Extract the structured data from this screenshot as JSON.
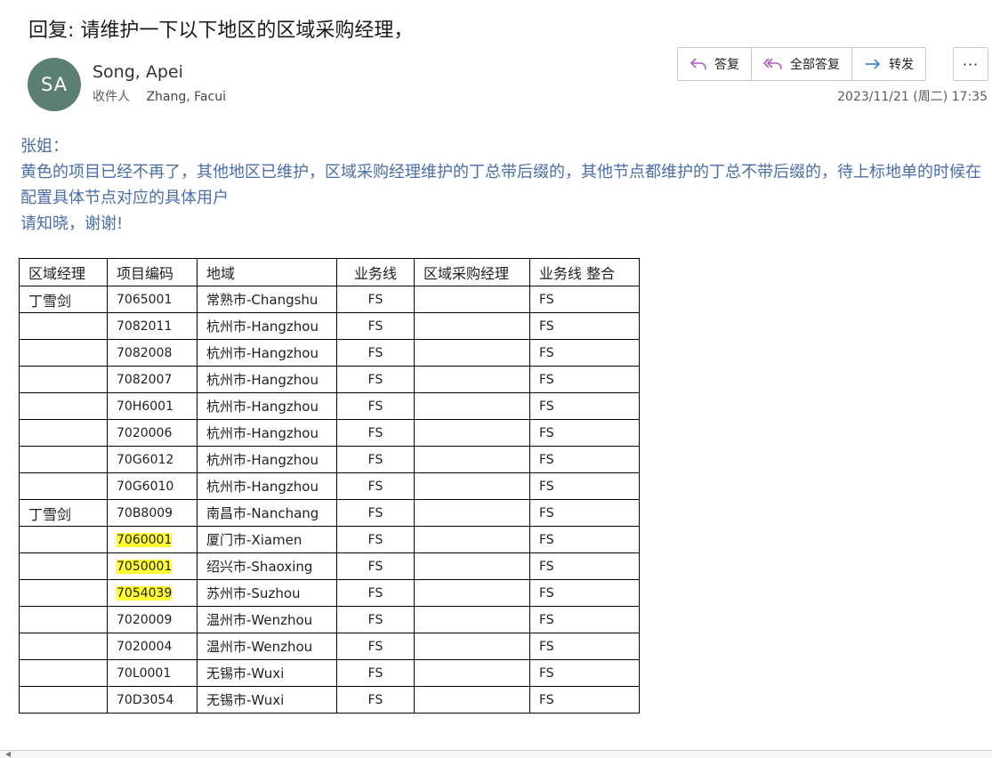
{
  "email": {
    "subject": "回复: 请维护一下以下地区的区域采购经理，",
    "avatar_initials": "SA",
    "sender": "Song, Apei",
    "to_label": "收件人",
    "to_name": "Zhang, Facui",
    "datetime": "2023/11/21 (周二) 17:35",
    "body": [
      "张姐：",
      "黄色的项目已经不再了，其他地区已维护，区域采购经理维护的丁总带后缀的，其他节点都维护的丁总不带后缀的，待上标地单的时候在配置具体节点对应的具体用户",
      "请知晓，谢谢!"
    ]
  },
  "actions": {
    "reply": "答复",
    "reply_all": "全部答复",
    "forward": "转发",
    "more": "···"
  },
  "colors": {
    "body_text": "#4a6ea9",
    "highlight": "#ffff33",
    "avatar": "#5b7f72",
    "reply_icon": "#b05fbf",
    "forward_icon": "#2a7fd4"
  },
  "table": {
    "headers": [
      "区域经理",
      "项目编码",
      "地域",
      "业务线",
      "区域采购经理",
      "业务线 整合"
    ],
    "rows": [
      {
        "manager": "丁雪剑",
        "code": "7065001",
        "location": "常熟市-Changshu",
        "line": "FS",
        "buyer": "",
        "merged": "FS",
        "highlight": false
      },
      {
        "manager": "",
        "code": "7082011",
        "location": "杭州市-Hangzhou",
        "line": "FS",
        "buyer": "",
        "merged": "FS",
        "highlight": false
      },
      {
        "manager": "",
        "code": "7082008",
        "location": "杭州市-Hangzhou",
        "line": "FS",
        "buyer": "",
        "merged": "FS",
        "highlight": false
      },
      {
        "manager": "",
        "code": "7082007",
        "location": "杭州市-Hangzhou",
        "line": "FS",
        "buyer": "",
        "merged": "FS",
        "highlight": false
      },
      {
        "manager": "",
        "code": "70H6001",
        "location": "杭州市-Hangzhou",
        "line": "FS",
        "buyer": "",
        "merged": "FS",
        "highlight": false
      },
      {
        "manager": "",
        "code": "7020006",
        "location": "杭州市-Hangzhou",
        "line": "FS",
        "buyer": "",
        "merged": "FS",
        "highlight": false
      },
      {
        "manager": "",
        "code": "70G6012",
        "location": "杭州市-Hangzhou",
        "line": "FS",
        "buyer": "",
        "merged": "FS",
        "highlight": false
      },
      {
        "manager": "",
        "code": "70G6010",
        "location": "杭州市-Hangzhou",
        "line": "FS",
        "buyer": "",
        "merged": "FS",
        "highlight": false
      },
      {
        "manager": "丁雪剑",
        "code": "70B8009",
        "location": "南昌市-Nanchang",
        "line": "FS",
        "buyer": "",
        "merged": "FS",
        "highlight": false
      },
      {
        "manager": "",
        "code": "7060001",
        "location": "厦门市-Xiamen",
        "line": "FS",
        "buyer": "",
        "merged": "FS",
        "highlight": true
      },
      {
        "manager": "",
        "code": "7050001",
        "location": "绍兴市-Shaoxing",
        "line": "FS",
        "buyer": "",
        "merged": "FS",
        "highlight": true
      },
      {
        "manager": "",
        "code": "7054039",
        "location": "苏州市-Suzhou",
        "line": "FS",
        "buyer": "",
        "merged": "FS",
        "highlight": true
      },
      {
        "manager": "",
        "code": "7020009",
        "location": "温州市-Wenzhou",
        "line": "FS",
        "buyer": "",
        "merged": "FS",
        "highlight": false
      },
      {
        "manager": "",
        "code": "7020004",
        "location": "温州市-Wenzhou",
        "line": "FS",
        "buyer": "",
        "merged": "FS",
        "highlight": false
      },
      {
        "manager": "",
        "code": "70L0001",
        "location": "无锡市-Wuxi",
        "line": "FS",
        "buyer": "",
        "merged": "FS",
        "highlight": false
      },
      {
        "manager": "",
        "code": "70D3054",
        "location": "无锡市-Wuxi",
        "line": "FS",
        "buyer": "",
        "merged": "FS",
        "highlight": false
      }
    ]
  }
}
